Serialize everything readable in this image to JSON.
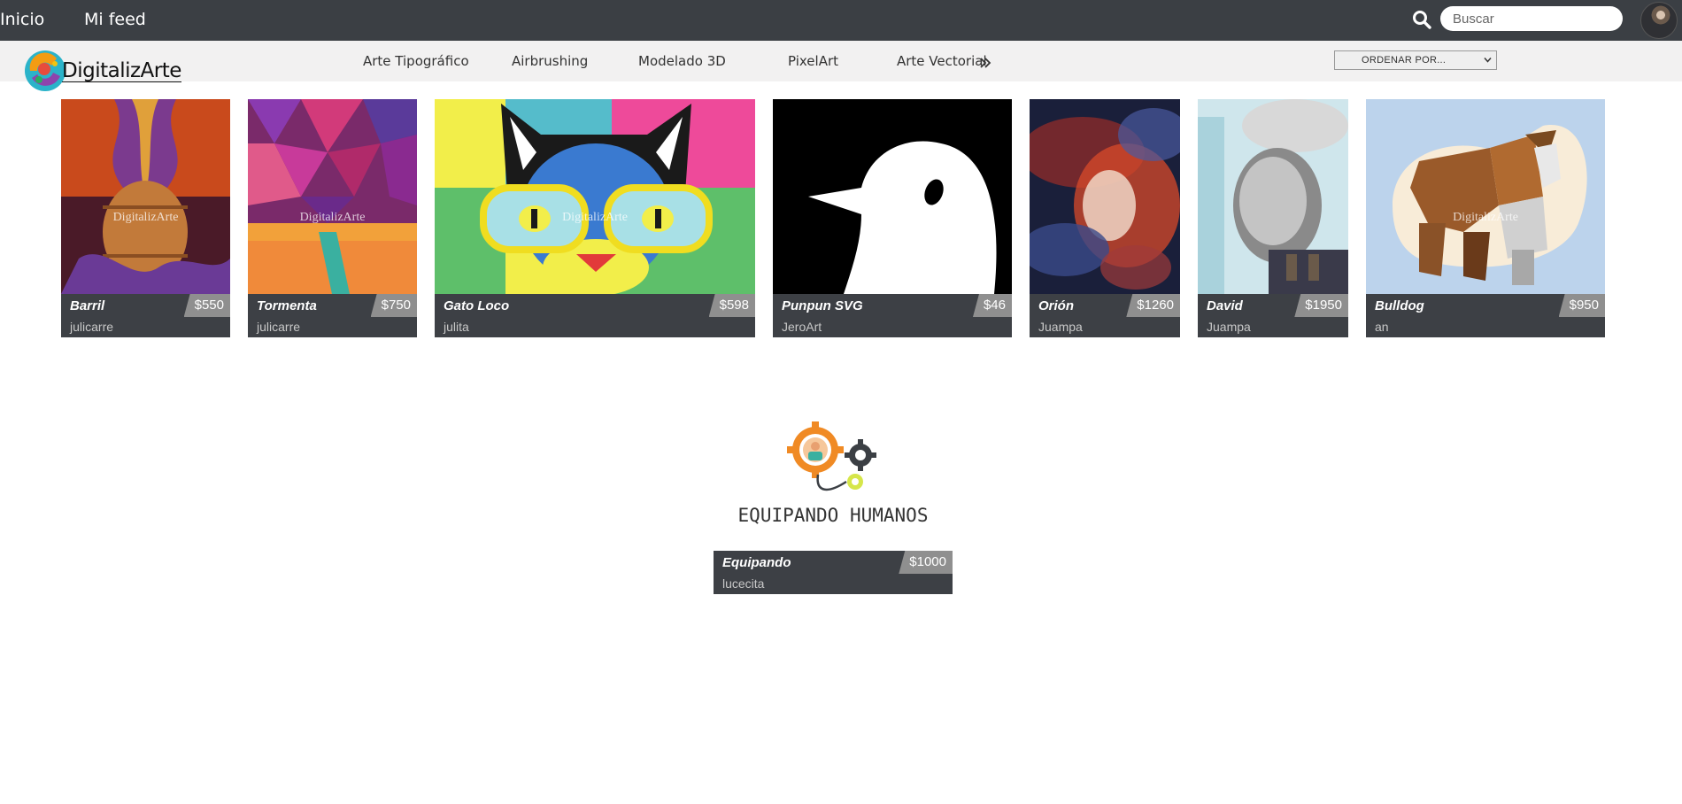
{
  "topbar": {
    "links": [
      {
        "label": "Inicio"
      },
      {
        "label": "Mi feed"
      }
    ],
    "search": {
      "placeholder": "Buscar",
      "value": ""
    },
    "icons": {
      "search": "search-icon",
      "avatar": "user-avatar"
    }
  },
  "brand": {
    "name": "DigitalizArte"
  },
  "categories": [
    {
      "label": "Arte Tipográfico"
    },
    {
      "label": "Airbrushing"
    },
    {
      "label": "Modelado 3D"
    },
    {
      "label": "PixelArt"
    },
    {
      "label": "Arte Vectorial"
    }
  ],
  "sort": {
    "label": "ORDENAR POR..."
  },
  "watermark": "DigitalizArte",
  "artworks": [
    {
      "title": "Barril",
      "author": "julicarre",
      "price": "$550"
    },
    {
      "title": "Tormenta",
      "author": "julicarre",
      "price": "$750"
    },
    {
      "title": "Gato Loco",
      "author": "julita",
      "price": "$598"
    },
    {
      "title": "Punpun SVG",
      "author": "JeroArt",
      "price": "$46"
    },
    {
      "title": "Orión",
      "author": "Juampa",
      "price": "$1260"
    },
    {
      "title": "David",
      "author": "Juampa",
      "price": "$1950"
    },
    {
      "title": "Bulldog",
      "author": "an",
      "price": "$950"
    },
    {
      "title": "Equipando",
      "author": "lucecita",
      "price": "$1000",
      "logo_text": "EQUIPANDO HUMANOS"
    }
  ],
  "colors": {
    "topbar": "#3b3f44",
    "catbar": "#f2f1f1",
    "card_info": "#3d4045",
    "price_tag": "#8f8f8f"
  }
}
